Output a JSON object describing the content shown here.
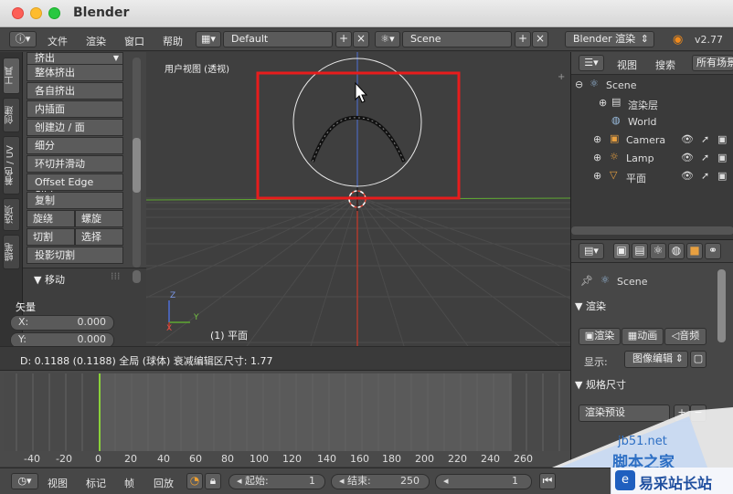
{
  "window": {
    "title": "Blender"
  },
  "topbar": {
    "menus": [
      "文件",
      "渲染",
      "窗口",
      "帮助"
    ],
    "screen_layout": "Default",
    "scene": "Scene",
    "engine": "Blender 渲染",
    "version": "v2.77"
  },
  "toolshelf": {
    "tabs": [
      "工具",
      "创建",
      "着色 / UV",
      "选项",
      "蜡笔"
    ],
    "section_header": "挤出",
    "tools": [
      "整体挤出",
      "各自挤出",
      "内插面",
      "创建边 / 面",
      "细分",
      "环切并滑动",
      "Offset Edge Slide",
      "复制"
    ],
    "paired_tools": [
      [
        "旋绕",
        "螺旋"
      ],
      [
        "切割",
        "选择"
      ]
    ],
    "last_tool": "投影切割",
    "operator_panel": {
      "title": "移动",
      "vector_label": "矢量",
      "x_label": "X:",
      "x_value": "0.000",
      "y_label": "Y:",
      "y_value": "0.000"
    }
  },
  "viewport": {
    "title": "用户视图 (透视)",
    "object_label": "(1) 平面",
    "status": "D: 0.1188 (0.1188) 全局 (球体) 衰减编辑区尺寸: 1.77",
    "axis_x": "X",
    "axis_y": "Y",
    "axis_z": "Z",
    "highlight_color": "#e81c1c"
  },
  "timeline": {
    "ticks": [
      "-40",
      "-20",
      "0",
      "20",
      "40",
      "60",
      "80",
      "100",
      "120",
      "140",
      "160",
      "180",
      "200",
      "220",
      "240",
      "260"
    ],
    "current_frame_color": "#8ad13a"
  },
  "bottombar": {
    "menus": [
      "视图",
      "标记",
      "帧",
      "回放"
    ],
    "start_label": "起始:",
    "start_value": "1",
    "end_label": "结束:",
    "end_value": "250",
    "current": "1"
  },
  "outliner": {
    "header": {
      "view": "视图",
      "search": "搜索",
      "filter": "所有场景"
    },
    "items": [
      {
        "name": "Scene",
        "icon": "scene-icon"
      },
      {
        "name": "渲染层",
        "icon": "render-layer-icon"
      },
      {
        "name": "World",
        "icon": "world-icon"
      },
      {
        "name": "Camera",
        "icon": "camera-icon"
      },
      {
        "name": "Lamp",
        "icon": "lamp-icon"
      },
      {
        "name": "平面",
        "icon": "mesh-icon"
      }
    ]
  },
  "properties": {
    "context": "Scene",
    "render_section": "渲染",
    "render_buttons": [
      "渲染",
      "动画",
      "音频"
    ],
    "display_label": "显示:",
    "display_value": "图像编辑",
    "dimensions_section": "规格尺寸",
    "render_presets": "渲染预设"
  },
  "watermark": {
    "site1": "jb51.net",
    "site1_sub": "脚本之家",
    "site2": "易采站长站"
  }
}
